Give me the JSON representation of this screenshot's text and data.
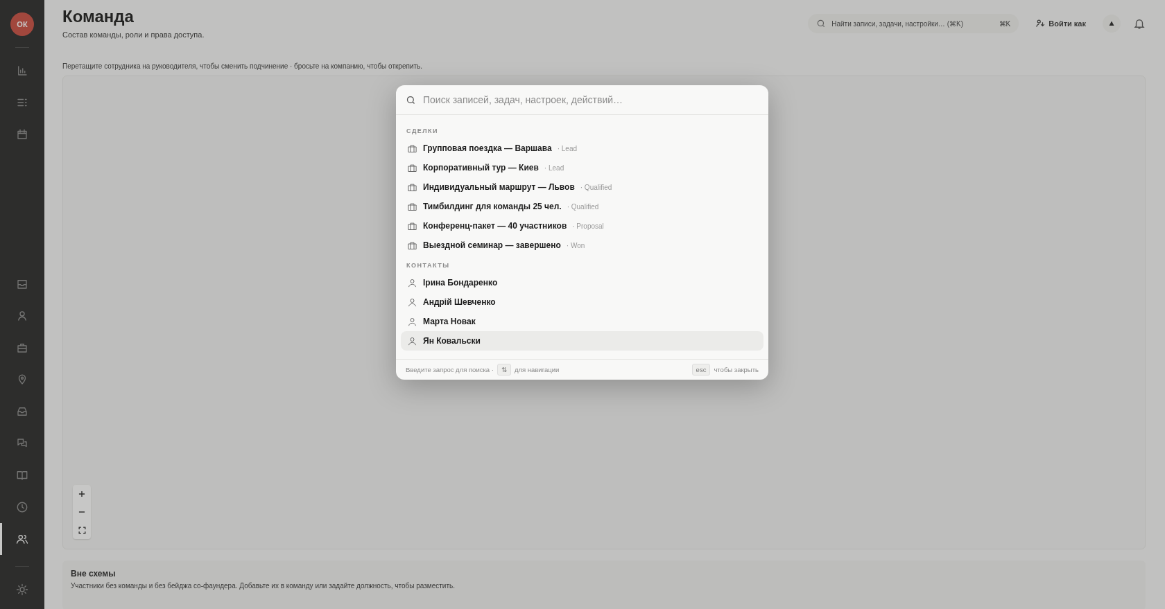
{
  "sidebar": {
    "avatar": "ОК",
    "items": [
      {
        "selected": false
      },
      {
        "selected": false
      },
      {
        "selected": false
      },
      {
        "selected": false
      },
      {
        "selected": false
      },
      {
        "selected": false
      },
      {
        "selected": false
      },
      {
        "selected": false
      },
      {
        "selected": false
      },
      {
        "selected": false
      },
      {
        "selected": false
      },
      {
        "selected": true
      },
      {
        "selected": false
      }
    ]
  },
  "header": {
    "title": "Команда",
    "subtitle": "Состав команды, роли и права доступа.",
    "search": {
      "placeholder": "Найти записи, задачи, настройки… (⌘K)",
      "shortcut": "⌘K"
    },
    "login_as": "Войти как"
  },
  "hint": "Перетащите сотрудника на руководителя, чтобы сменить подчинение · бросьте на компанию, чтобы открепить.",
  "outside": {
    "title": "Вне схемы",
    "text": "Участники без команды и без бейджа со-фаундера. Добавьте их в команду или задайте должность, чтобы разместить."
  },
  "palette": {
    "placeholder": "Поиск записей, задач, настроек, действий…",
    "sections": [
      {
        "heading": "СДЕЛКИ",
        "kind": "deal",
        "items": [
          {
            "title": "Групповая поездка — Варшава",
            "stage": "· Lead",
            "selected": false
          },
          {
            "title": "Корпоративный тур — Киев",
            "stage": "· Lead",
            "selected": false
          },
          {
            "title": "Индивидуальный маршрут — Львов",
            "stage": "· Qualified",
            "selected": false
          },
          {
            "title": "Тимбилдинг для команды 25 чел.",
            "stage": "· Qualified",
            "selected": false
          },
          {
            "title": "Конференц-пакет — 40 участников",
            "stage": "· Proposal",
            "selected": false
          },
          {
            "title": "Выездной семинар — завершено",
            "stage": "· Won",
            "selected": false
          }
        ]
      },
      {
        "heading": "КОНТАКТЫ",
        "kind": "contact",
        "items": [
          {
            "title": "Ірина Бондаренко",
            "selected": false
          },
          {
            "title": "Андрій Шевченко",
            "selected": false
          },
          {
            "title": "Марта Новак",
            "selected": false
          },
          {
            "title": "Ян Ковальски",
            "selected": true
          }
        ]
      }
    ],
    "footer": {
      "left": "Введите запрос для поиска ·",
      "nav_key": "⇅",
      "nav_text": "для навигации",
      "esc_key": "esc",
      "esc_text": "чтобы закрыть"
    }
  }
}
